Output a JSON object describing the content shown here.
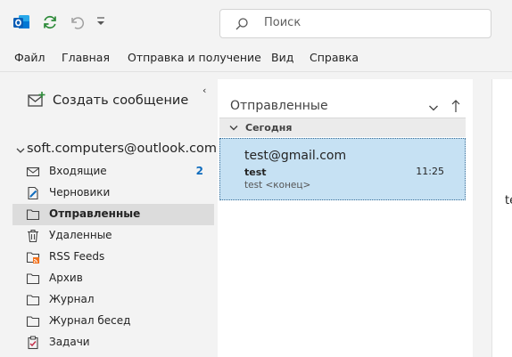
{
  "search": {
    "placeholder": "Поиск"
  },
  "menu": [
    "Файл",
    "Главная",
    "Отправка и получение",
    "Вид",
    "Справка"
  ],
  "folder_pane": {
    "new_message_label": "Создать сообщение",
    "account": "soft.computers@outlook.com",
    "folders": [
      {
        "label": "Входящие",
        "icon": "inbox-icon",
        "count": "2",
        "selected": false
      },
      {
        "label": "Черновики",
        "icon": "drafts-icon",
        "count": "",
        "selected": false
      },
      {
        "label": "Отправленные",
        "icon": "folder-icon",
        "count": "",
        "selected": true
      },
      {
        "label": "Удаленные",
        "icon": "trash-icon",
        "count": "",
        "selected": false
      },
      {
        "label": "RSS Feeds",
        "icon": "rss-icon",
        "count": "",
        "selected": false
      },
      {
        "label": "Архив",
        "icon": "folder-icon",
        "count": "",
        "selected": false
      },
      {
        "label": "Журнал",
        "icon": "folder-icon",
        "count": "",
        "selected": false
      },
      {
        "label": "Журнал бесед",
        "icon": "folder-icon",
        "count": "",
        "selected": false
      },
      {
        "label": "Задачи",
        "icon": "tasks-icon",
        "count": "",
        "selected": false
      }
    ]
  },
  "message_list": {
    "title": "Отправленные",
    "group": "Сегодня",
    "messages": [
      {
        "from": "test@gmail.com",
        "subject": "test",
        "time": "11:25",
        "preview": "test <конец>"
      }
    ]
  },
  "reading_pane": {
    "partial_text": "te"
  },
  "colors": {
    "accent": "#0f6cbd",
    "selection": "#c6e1f3",
    "selected_folder": "#dcdcdc"
  }
}
